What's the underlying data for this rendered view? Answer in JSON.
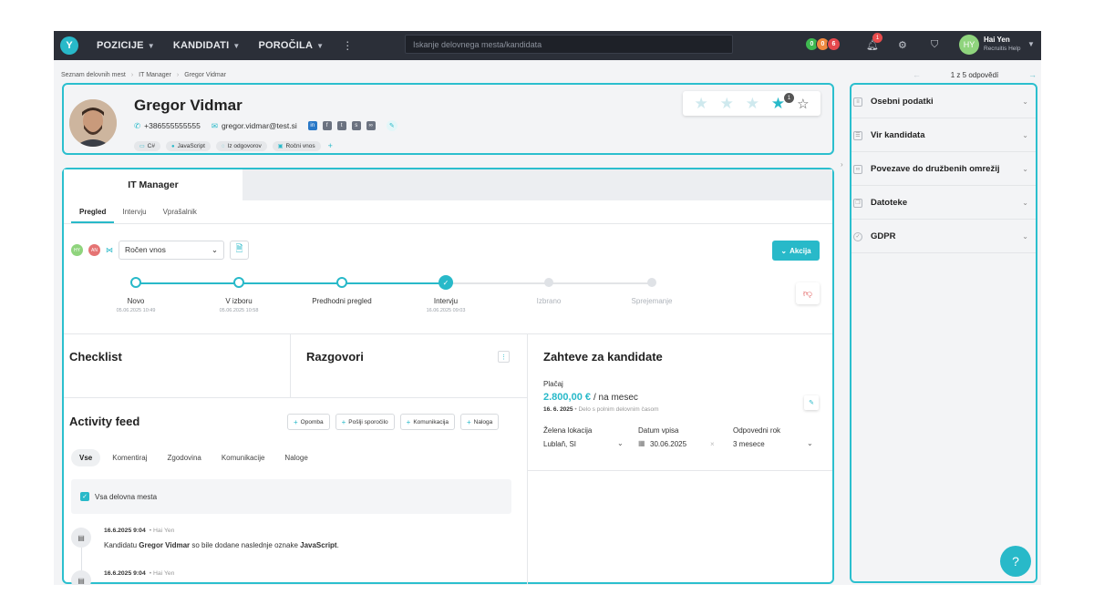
{
  "topbar": {
    "nav": [
      {
        "label": "POZICIJE"
      },
      {
        "label": "KANDIDATI"
      },
      {
        "label": "POROČILA"
      }
    ],
    "search_placeholder": "Iskanje delovnega mesta/kandidata",
    "counters": [
      {
        "value": "0",
        "color": "#3fb950"
      },
      {
        "value": "0",
        "color": "#f0883e"
      },
      {
        "value": "6",
        "color": "#e5484d"
      }
    ],
    "notification_count": "1",
    "user": {
      "initials": "HY",
      "name": "Hai Yen",
      "role": "Recruitis Help"
    }
  },
  "breadcrumb": [
    "Seznam delovnih mest",
    "IT Manager",
    "Gregor Vidmar"
  ],
  "pager": {
    "text": "1 z 5 odpovědí"
  },
  "candidate": {
    "name": "Gregor Vidmar",
    "phone": "+386555555555",
    "email": "gregor.vidmar@test.si",
    "tags": [
      {
        "icon": "monitor-icon",
        "label": "C#"
      },
      {
        "icon": "person-icon",
        "label": "JavaScript"
      },
      {
        "icon": "chat-icon",
        "label": "Iz odgovorov"
      },
      {
        "icon": "briefcase-icon",
        "label": "Ročni vnos"
      }
    ],
    "rating": {
      "value": 4,
      "max": 5,
      "count": "1"
    }
  },
  "job": {
    "title": "IT Manager",
    "tabs": [
      "Pregled",
      "Intervju",
      "Vprašalnik"
    ],
    "active_tab": 0,
    "assignees": [
      {
        "initials": "HY",
        "color": "#8fd47d"
      },
      {
        "initials": "AN",
        "color": "#e57373"
      }
    ],
    "source_select": "Ročen vnos",
    "action_label": "Akcija",
    "steps": [
      {
        "label": "Novo",
        "date": "05.06.2025 10:49",
        "state": "done"
      },
      {
        "label": "V izboru",
        "date": "05.06.2025 10:58",
        "state": "done"
      },
      {
        "label": "Predhodni pregled",
        "date": "",
        "state": "done"
      },
      {
        "label": "Intervju",
        "date": "16.06.2025 09:03",
        "state": "current"
      },
      {
        "label": "Izbrano",
        "date": "",
        "state": "todo"
      },
      {
        "label": "Sprejemanje",
        "date": "",
        "state": "todo"
      }
    ]
  },
  "sections": {
    "checklist": "Checklist",
    "conversations": "Razgovori",
    "activity": "Activity feed",
    "requirements": "Zahteve za kandidate"
  },
  "activity": {
    "buttons": [
      "Opomba",
      "Pošlji sporočilo",
      "Komunikacija",
      "Naloga"
    ],
    "filters": [
      "Vse",
      "Komentiraj",
      "Zgodovina",
      "Komunikacije",
      "Naloge"
    ],
    "active_filter": 0,
    "all_jobs_label": "Vsa delovna mesta",
    "items": [
      {
        "date": "16.6.2025 9:04",
        "author": "Hai Yen",
        "pre": "Kandidatu ",
        "b1": "Gregor Vidmar",
        "mid": " so bile dodane naslednje oznake ",
        "b2": "JavaScript",
        "post": "."
      },
      {
        "date": "16.6.2025 9:04",
        "author": "Hai Yen"
      }
    ]
  },
  "requirements": {
    "salary_label": "Plačaj",
    "salary_value": "2.800,00 €",
    "salary_unit": "/ na mesec",
    "salary_date": "16. 6. 2025",
    "salary_note": "Delo s polnim delovnim časom",
    "location_label": "Želena lokacija",
    "location_value": "Lublaň, SI",
    "start_label": "Datum vpisa",
    "start_value": "30.06.2025",
    "notice_label": "Odpovedni rok",
    "notice_value": "3 mesece"
  },
  "sidebar": {
    "items": [
      {
        "label": "Osebni podatki",
        "icon": "id-card-icon"
      },
      {
        "label": "Vir kandidata",
        "icon": "source-icon"
      },
      {
        "label": "Povezave do družbenih omrežij",
        "icon": "link-icon"
      },
      {
        "label": "Datoteke",
        "icon": "files-icon"
      },
      {
        "label": "GDPR",
        "icon": "check-circle-icon"
      }
    ]
  },
  "colors": {
    "accent": "#28b9c9",
    "topbar": "#2b2f38",
    "highlight": "#2bbfce"
  }
}
